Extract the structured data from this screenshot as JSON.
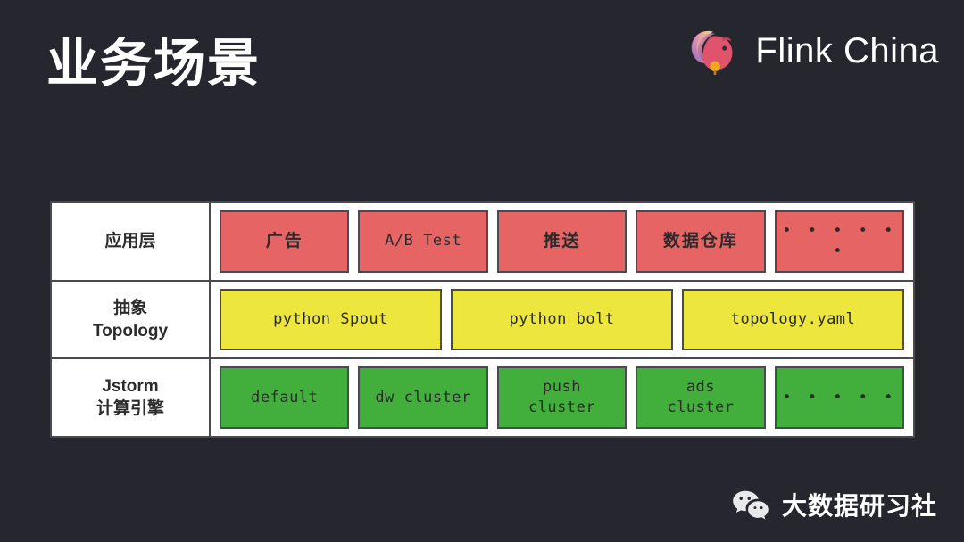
{
  "slide": {
    "title": "业务场景",
    "background_color": "#26262F"
  },
  "brand": {
    "name": "Flink China",
    "logo_icon": "flink-squirrel-icon"
  },
  "footer": {
    "icon": "wechat-icon",
    "text": "大数据研习社"
  },
  "colors": {
    "application_layer": "#E66464",
    "topology_layer": "#EDE63D",
    "engine_layer": "#42AE3C",
    "border": "#4A4A52",
    "table_background": "#FFFFFF"
  },
  "diagram": {
    "type": "layered-architecture-table",
    "rows": [
      {
        "label": "应用层",
        "color": "#E66464",
        "cells": [
          {
            "text": "广告",
            "script": "cjk"
          },
          {
            "text": "A/B Test",
            "script": "mono"
          },
          {
            "text": "推送",
            "script": "cjk"
          },
          {
            "text": "数据仓库",
            "script": "cjk"
          },
          {
            "text": "• • • • • •",
            "script": "dots"
          }
        ]
      },
      {
        "label": "抽象\nTopology",
        "color": "#EDE63D",
        "cells": [
          {
            "text": "python Spout",
            "script": "mono"
          },
          {
            "text": "python bolt",
            "script": "mono"
          },
          {
            "text": "topology.yaml",
            "script": "mono"
          }
        ]
      },
      {
        "label": "Jstorm\n计算引擎",
        "color": "#42AE3C",
        "cells": [
          {
            "text": "default",
            "script": "mono"
          },
          {
            "text": "dw cluster",
            "script": "mono"
          },
          {
            "text": "push\ncluster",
            "script": "mono"
          },
          {
            "text": "ads\ncluster",
            "script": "mono"
          },
          {
            "text": "• • • • •",
            "script": "dots"
          }
        ]
      }
    ]
  }
}
